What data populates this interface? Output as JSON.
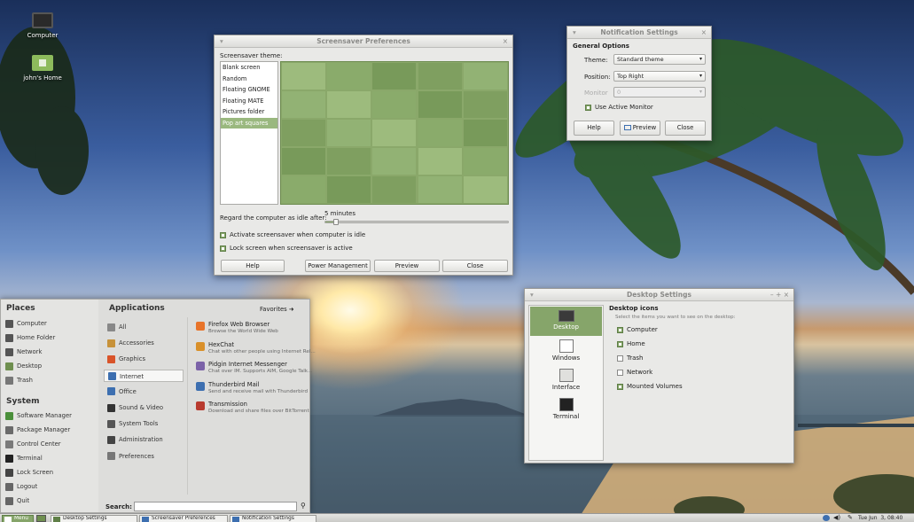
{
  "desktop": {
    "icons": [
      {
        "label": "Computer",
        "icon": "monitor-icon"
      },
      {
        "label": "john's Home",
        "icon": "home-folder-icon"
      }
    ]
  },
  "screensaver": {
    "title": "Screensaver Preferences",
    "theme_label": "Screensaver theme:",
    "themes": [
      "Blank screen",
      "Random",
      "Floating GNOME",
      "Floating MATE",
      "Pictures folder",
      "Pop art squares"
    ],
    "selected_theme": "Pop art squares",
    "idle_label": "Regard the computer as idle after:",
    "idle_value": "5 minutes",
    "idle_fraction": 0.05,
    "activate_label": "Activate screensaver when computer is idle",
    "activate_checked": true,
    "lock_label": "Lock screen when screensaver is active",
    "lock_checked": true,
    "help": "Help",
    "power": "Power Management",
    "preview": "Preview",
    "close": "Close"
  },
  "notification": {
    "title": "Notification Settings",
    "group": "General Options",
    "theme_label": "Theme:",
    "theme_value": "Standard theme",
    "position_label": "Position:",
    "position_value": "Top Right",
    "monitor_label": "Monitor",
    "monitor_value": "0",
    "active_monitor_label": "Use Active Monitor",
    "active_monitor_checked": true,
    "help": "Help",
    "preview": "Preview",
    "close": "Close"
  },
  "desktop_settings": {
    "title": "Desktop Settings",
    "tabs": [
      "Desktop",
      "Windows",
      "Interface",
      "Terminal"
    ],
    "active_tab": "Desktop",
    "section": "Desktop icons",
    "hint": "Select the items you want to see on the desktop:",
    "items": [
      {
        "label": "Computer",
        "checked": true
      },
      {
        "label": "Home",
        "checked": true
      },
      {
        "label": "Trash",
        "checked": false
      },
      {
        "label": "Network",
        "checked": false
      },
      {
        "label": "Mounted Volumes",
        "checked": true
      }
    ]
  },
  "menu": {
    "places_title": "Places",
    "places": [
      "Computer",
      "Home Folder",
      "Network",
      "Desktop",
      "Trash"
    ],
    "system_title": "System",
    "system": [
      "Software Manager",
      "Package Manager",
      "Control Center",
      "Terminal",
      "Lock Screen",
      "Logout",
      "Quit"
    ],
    "apps_title": "Applications",
    "favorites": "Favorites",
    "categories": [
      "All",
      "Accessories",
      "Graphics",
      "Internet",
      "Office",
      "Sound & Video",
      "System Tools",
      "Administration",
      "Preferences"
    ],
    "active_category": "Internet",
    "apps": [
      {
        "name": "Firefox Web Browser",
        "desc": "Browse the World Wide Web",
        "color": "#e8742a"
      },
      {
        "name": "HexChat",
        "desc": "Chat with other people using Internet Rel...",
        "color": "#d9902a"
      },
      {
        "name": "Pidgin Internet Messenger",
        "desc": "Chat over IM.  Supports AIM, Google Talk...",
        "color": "#7b62a8"
      },
      {
        "name": "Thunderbird Mail",
        "desc": "Send and receive mail with Thunderbird",
        "color": "#3d6fb0"
      },
      {
        "name": "Transmission",
        "desc": "Download and share files over BitTorrent",
        "color": "#b83a2e"
      }
    ],
    "search_label": "Search:"
  },
  "taskbar": {
    "menu": "Menu",
    "windows": [
      "Desktop Settings",
      "Screensaver Preferences",
      "Notification Settings"
    ],
    "clock": "Tue Jun  3, 08:40"
  },
  "colors": {
    "accent": "#86a56a",
    "selection": "#9ab87f"
  }
}
